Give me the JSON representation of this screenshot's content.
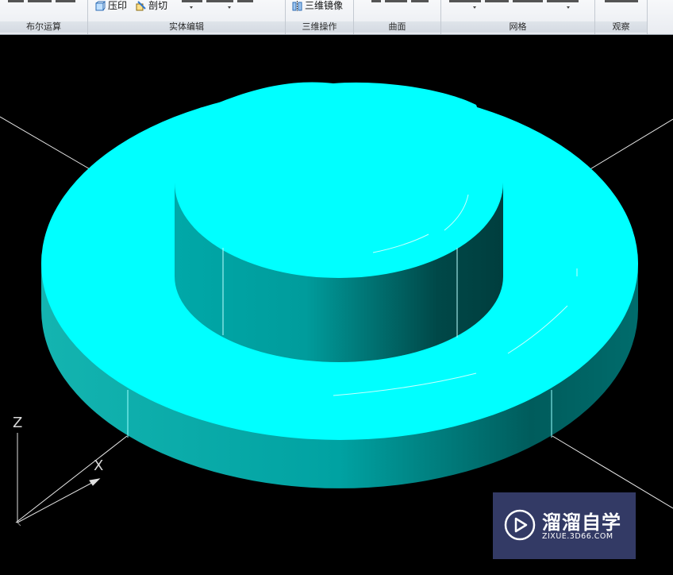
{
  "ribbon": {
    "panels": [
      {
        "title": "布尔运算"
      },
      {
        "title": "实体编辑",
        "buttons": {
          "imprint": "压印",
          "section": "剖切"
        }
      },
      {
        "title": "三维操作",
        "buttons": {
          "mirror3d": "三维镜像"
        }
      },
      {
        "title": "曲面"
      },
      {
        "title": "网格"
      },
      {
        "title": "观察"
      }
    ]
  },
  "viewport": {
    "background": "#000000",
    "solid_color": "#00ffff",
    "ucs": {
      "z_label": "Z",
      "x_label": "X"
    }
  },
  "watermark": {
    "title": "溜溜自学",
    "subtitle": "ZIXUE.3D66.COM",
    "logo": "play-icon"
  }
}
